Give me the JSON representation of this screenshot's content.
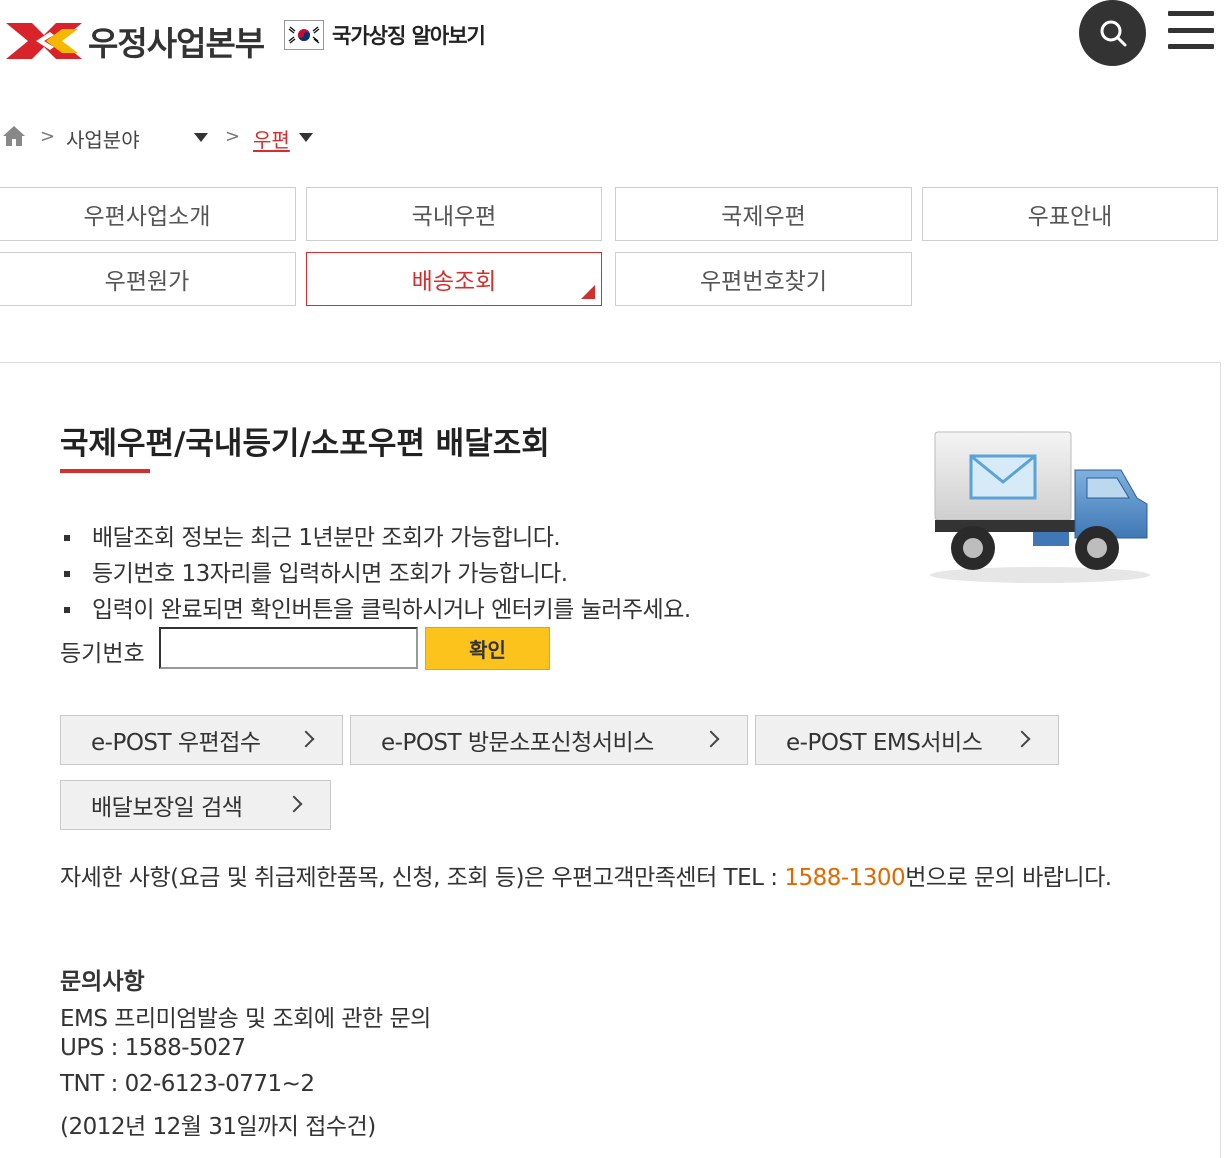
{
  "header": {
    "logo_text": "우정사업본부",
    "symbol_link": "국가상징 알아보기",
    "icons": {
      "search": "search-icon",
      "menu": "hamburger-menu-icon",
      "flag": "korean-flag-icon",
      "home": "home-icon"
    },
    "colors": {
      "brand_red": "#d32f2f",
      "brand_yellow": "#f5b800",
      "dark": "#333333"
    }
  },
  "breadcrumb": {
    "sep": ">",
    "item1": "사업분야",
    "item2": "우편"
  },
  "tabs": [
    {
      "label": "우편사업소개",
      "active": false
    },
    {
      "label": "국내우편",
      "active": false
    },
    {
      "label": "국제우편",
      "active": false
    },
    {
      "label": "우표안내",
      "active": false
    },
    {
      "label": "우편원가",
      "active": false
    },
    {
      "label": "배송조회",
      "active": true
    },
    {
      "label": "우편번호찾기",
      "active": false
    }
  ],
  "main": {
    "title": "국제우편/국내등기/소포우편 배달조회",
    "notes": [
      "배달조회 정보는 최근 1년분만 조회가 가능합니다.",
      "등기번호 13자리를 입력하시면 조회가 가능합니다.",
      "입력이 완료되면 확인버튼을 클릭하시거나 엔터키를 눌러주세요."
    ],
    "reg_label": "등기번호",
    "reg_value": "",
    "confirm_label": "확인",
    "links": [
      "e-POST 우편접수",
      "e-POST 방문소포신청서비스",
      "e-POST EMS서비스",
      "배달보장일 검색"
    ],
    "info_before": "자세한 사항(요금 및 취급제한품목, 신청, 조회 등)은 우편고객만족센터 TEL : ",
    "info_phone": "1588-1300",
    "info_after": "번으로 문의 바랍니다.",
    "inquiry_title": "문의사항",
    "inquiry_lines": [
      "EMS 프리미엄발송 및 조회에 관한 문의",
      "UPS : 1588-5027",
      "TNT : 02-6123-0771~2",
      "(2012년 12월 31일까지 접수건)"
    ]
  }
}
